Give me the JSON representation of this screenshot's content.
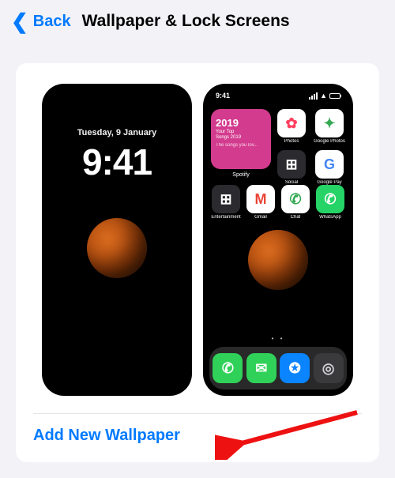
{
  "header": {
    "back_label": "Back",
    "title": "Wallpaper & Lock Screens"
  },
  "lock_preview": {
    "date": "Tuesday, 9 January",
    "time": "9:41"
  },
  "home_preview": {
    "status_time": "9:41",
    "widget": {
      "year": "2019",
      "line1": "Your Top",
      "line2": "Songs 2019",
      "sub": "The songs you lov...",
      "label": "Spotify"
    },
    "top_apps": [
      {
        "label": "Photos",
        "bg": "#ffffff",
        "glyph": "✿",
        "color": "#ff4060"
      },
      {
        "label": "Google Photos",
        "bg": "#ffffff",
        "glyph": "✦",
        "color": "#34a853"
      },
      {
        "label": "Social",
        "bg": "#2b2b2f",
        "glyph": "⊞",
        "color": "#ffffff"
      },
      {
        "label": "Google Pay",
        "bg": "#ffffff",
        "glyph": "G",
        "color": "#4285f4"
      }
    ],
    "row_apps": [
      {
        "label": "Entertainment",
        "bg": "#2b2b2f",
        "glyph": "⊞",
        "color": "#ffffff"
      },
      {
        "label": "Gmail",
        "bg": "#ffffff",
        "glyph": "M",
        "color": "#ea4335"
      },
      {
        "label": "Chat",
        "bg": "#ffffff",
        "glyph": "✆",
        "color": "#34a853"
      },
      {
        "label": "WhatsApp",
        "bg": "#25d366",
        "glyph": "✆",
        "color": "#ffffff"
      }
    ],
    "dock_apps": [
      {
        "bg": "#30d158",
        "glyph": "✆",
        "color": "#ffffff"
      },
      {
        "bg": "#30d158",
        "glyph": "✉",
        "color": "#ffffff"
      },
      {
        "bg": "#0b84ff",
        "glyph": "✪",
        "color": "#ffffff"
      },
      {
        "bg": "#3a3a3c",
        "glyph": "◎",
        "color": "#d1d1d6"
      }
    ],
    "pager": "• •"
  },
  "actions": {
    "add_wallpaper": "Add New Wallpaper"
  }
}
